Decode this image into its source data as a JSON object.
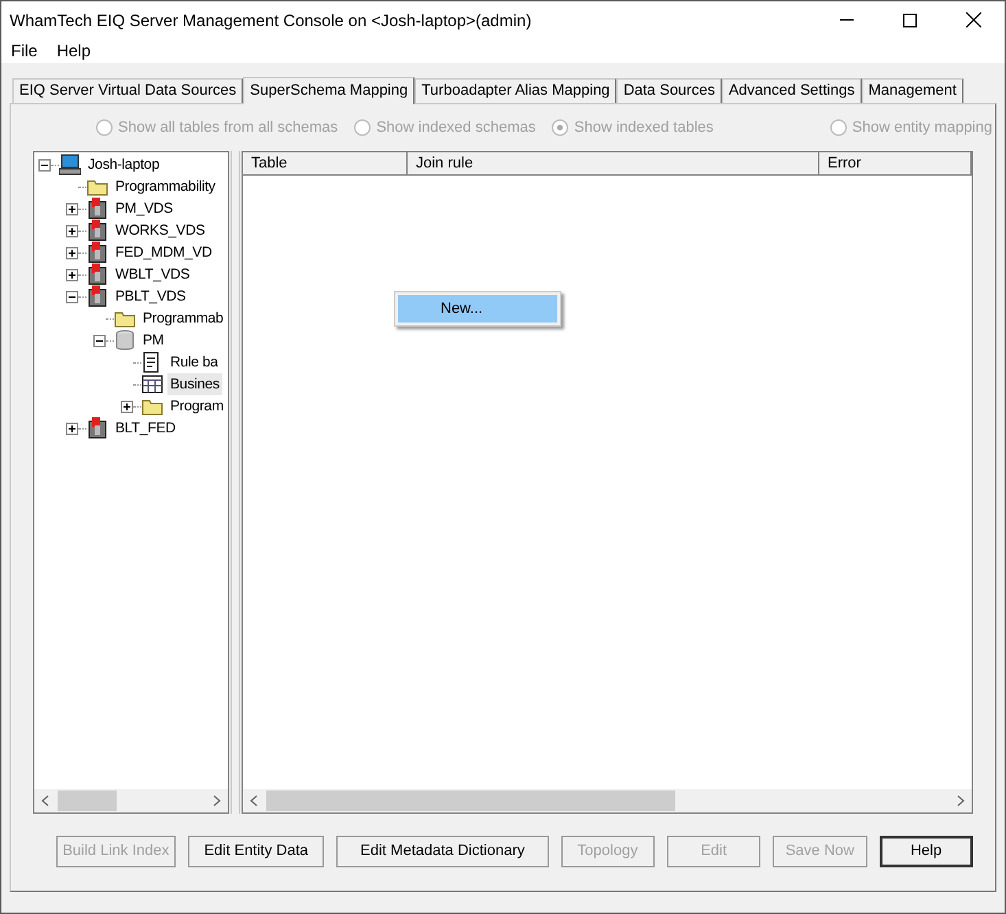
{
  "window": {
    "title": "WhamTech EIQ Server Management Console on <Josh-laptop>(admin)"
  },
  "menu": [
    "File",
    "Help"
  ],
  "tabs": [
    {
      "label": "EIQ Server Virtual Data Sources",
      "selected": false
    },
    {
      "label": "SuperSchema Mapping",
      "selected": true
    },
    {
      "label": "Turboadapter Alias Mapping",
      "selected": false
    },
    {
      "label": "Data Sources",
      "selected": false
    },
    {
      "label": "Advanced Settings",
      "selected": false
    },
    {
      "label": "Management",
      "selected": false
    }
  ],
  "view_options": [
    {
      "label": "Show all tables from all schemas",
      "selected": false,
      "disabled": true
    },
    {
      "label": "Show indexed schemas",
      "selected": false,
      "disabled": true
    },
    {
      "label": "Show indexed tables",
      "selected": true,
      "disabled": true
    },
    {
      "label": "Show entity mapping",
      "selected": false,
      "disabled": true
    }
  ],
  "tree": [
    {
      "label": "Josh-laptop",
      "kind": "computer",
      "expanded": true,
      "selected": false,
      "children": [
        {
          "label": "Programmability",
          "kind": "folder",
          "selected": false
        },
        {
          "label": "PM_VDS",
          "kind": "vds",
          "expanded": false,
          "selected": false
        },
        {
          "label": "WORKS_VDS",
          "kind": "vds",
          "expanded": false,
          "selected": false
        },
        {
          "label": "FED_MDM_VD",
          "kind": "vds",
          "expanded": false,
          "selected": false
        },
        {
          "label": "WBLT_VDS",
          "kind": "vds",
          "expanded": false,
          "selected": false
        },
        {
          "label": "PBLT_VDS",
          "kind": "vds",
          "expanded": true,
          "selected": false,
          "children": [
            {
              "label": "Programmab",
              "kind": "folder",
              "selected": false
            },
            {
              "label": "PM",
              "kind": "database",
              "expanded": true,
              "selected": false,
              "children": [
                {
                  "label": "Rule ba",
                  "kind": "rule",
                  "selected": false
                },
                {
                  "label": "Busines",
                  "kind": "table",
                  "selected": true
                },
                {
                  "label": "Program",
                  "kind": "folder",
                  "expanded": false,
                  "selected": false
                }
              ]
            }
          ]
        },
        {
          "label": "BLT_FED",
          "kind": "vds",
          "expanded": false,
          "selected": false
        }
      ]
    }
  ],
  "table": {
    "columns": [
      "Table",
      "Join rule",
      "Error"
    ]
  },
  "context_menu": {
    "items": [
      {
        "label": "New...",
        "selected": true
      }
    ]
  },
  "buttons": [
    {
      "label": "Build Link Index",
      "disabled": true,
      "default": false
    },
    {
      "label": "Edit Entity Data",
      "disabled": false,
      "default": false
    },
    {
      "label": "Edit Metadata Dictionary",
      "disabled": false,
      "default": false
    },
    {
      "label": "Topology",
      "disabled": true,
      "default": false
    },
    {
      "label": "Edit",
      "disabled": true,
      "default": false
    },
    {
      "label": "Save Now",
      "disabled": true,
      "default": false
    },
    {
      "label": "Help",
      "disabled": false,
      "default": true
    }
  ]
}
